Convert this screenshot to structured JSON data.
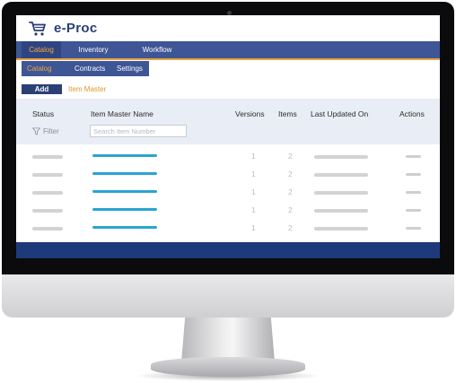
{
  "app": {
    "title": "e-Proc"
  },
  "main_nav": {
    "tabs": [
      {
        "label": "Catalog",
        "active": true
      },
      {
        "label": "Inventory",
        "active": false
      },
      {
        "label": "Workflow",
        "active": false
      }
    ]
  },
  "sub_nav": {
    "tabs": [
      {
        "label": "Catalog",
        "active": true
      },
      {
        "label": "Contracts",
        "active": false
      },
      {
        "label": "Settings",
        "active": false
      }
    ]
  },
  "toolbar": {
    "add_label": "Add",
    "breadcrumb": "Item Master"
  },
  "table": {
    "columns": [
      "Status",
      "Item Master Name",
      "Versions",
      "Items",
      "Last Updated On",
      "Actions"
    ],
    "filter_label": "Filter",
    "search_placeholder": "Search Item Number",
    "rows": [
      {
        "versions": "1",
        "items": "2"
      },
      {
        "versions": "1",
        "items": "2"
      },
      {
        "versions": "1",
        "items": "2"
      },
      {
        "versions": "1",
        "items": "2"
      },
      {
        "versions": "1",
        "items": "2"
      }
    ]
  },
  "colors": {
    "nav_blue": "#3e5596",
    "accent_orange": "#f2a642",
    "title_navy": "#2a3f73",
    "link_blue": "#2aa4d3",
    "footer_blue": "#1e3a7a"
  },
  "icons": {
    "app_logo": "shopping-cart-icon",
    "filter": "funnel-icon"
  }
}
